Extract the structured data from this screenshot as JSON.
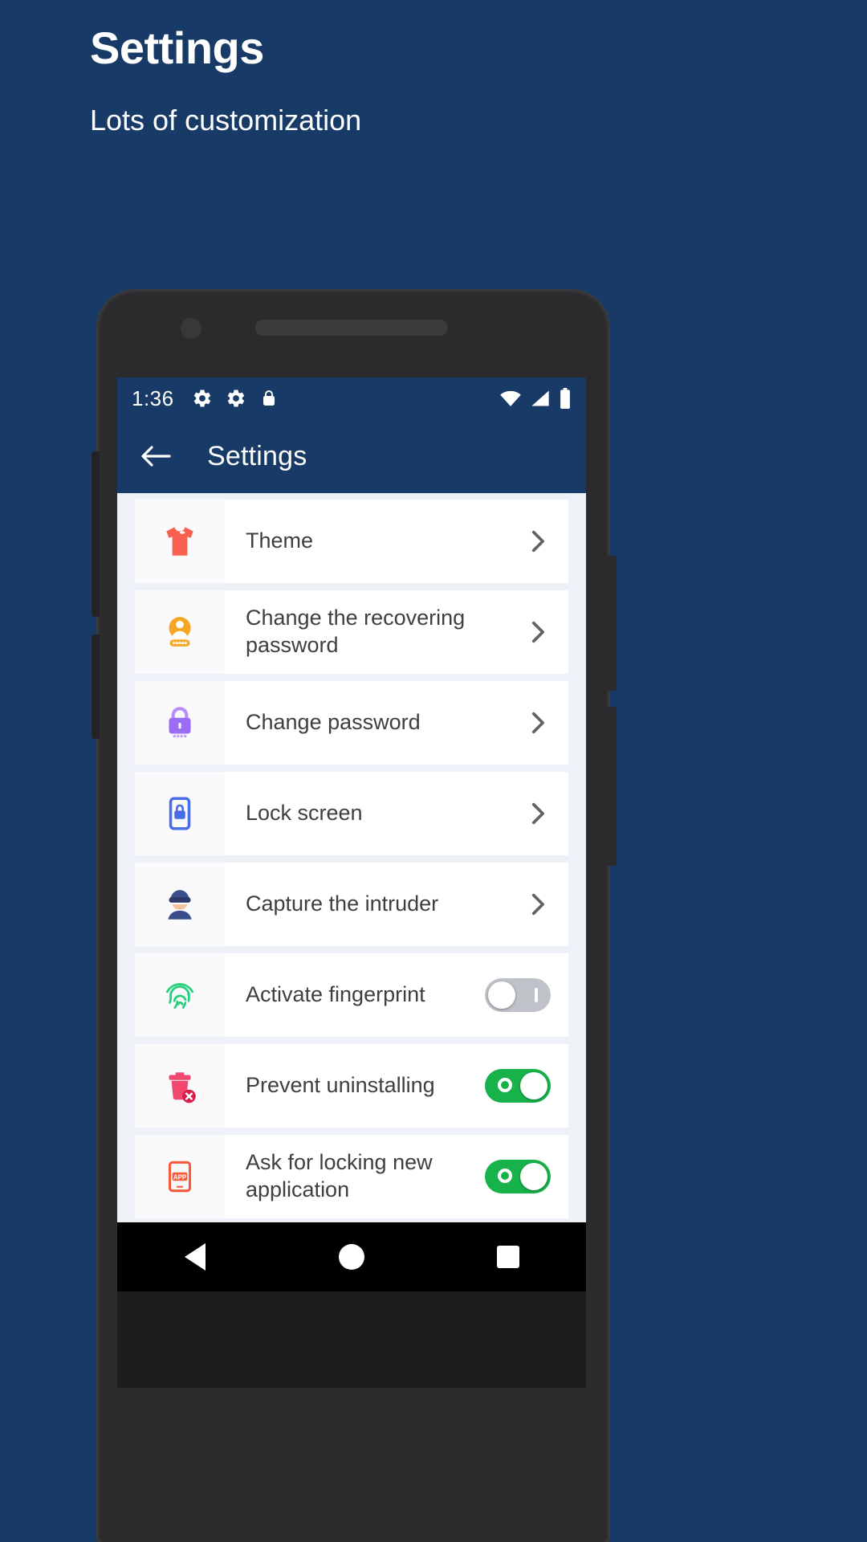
{
  "promo": {
    "title": "Settings",
    "subtitle": "Lots of customization",
    "background_color": "#173A66",
    "text_color": "#FFFFFF"
  },
  "phone": {
    "status_bar": {
      "time": "1:36",
      "left_icons": [
        "gear-icon",
        "gear-icon",
        "lock-icon"
      ],
      "right_icons": [
        "wifi-icon",
        "signal-icon",
        "battery-icon"
      ],
      "background_color": "#173A66"
    },
    "app_bar": {
      "back_label": "Back",
      "title": "Settings",
      "background_color": "#173A66"
    },
    "nav_bar": {
      "back_label": "Back",
      "home_label": "Home",
      "recents_label": "Recents"
    }
  },
  "settings_list": {
    "background_color": "#EFF1F9",
    "items": [
      {
        "label": "Theme",
        "icon": "tshirt-icon",
        "icon_color": "#F8604F",
        "control": "chevron"
      },
      {
        "label": "Change the recovering password",
        "icon": "user-password-icon",
        "icon_color": "#F5A623",
        "control": "chevron"
      },
      {
        "label": "Change password",
        "icon": "padlock-icon",
        "icon_color": "#9B6CF5",
        "control": "chevron"
      },
      {
        "label": "Lock screen",
        "icon": "phone-lock-icon",
        "icon_color": "#4B6CE8",
        "control": "chevron"
      },
      {
        "label": "Capture the intruder",
        "icon": "intruder-icon",
        "icon_color": "#3B4E8C",
        "control": "chevron"
      },
      {
        "label": "Activate fingerprint",
        "icon": "fingerprint-icon",
        "icon_color": "#25D07A",
        "control": "toggle",
        "toggle_state": "off"
      },
      {
        "label": "Prevent uninstalling",
        "icon": "uninstall-icon",
        "icon_color": "#F2486F",
        "control": "toggle",
        "toggle_state": "on"
      },
      {
        "label": "Ask for locking new application",
        "icon": "app-icon",
        "icon_color": "#FA5A3C",
        "control": "toggle",
        "toggle_state": "on"
      }
    ]
  },
  "colors": {
    "accent_navy": "#173A66",
    "toggle_on": "#18B24B",
    "toggle_off": "#BFC3C9",
    "row_white": "#FFFFFF",
    "icon_cell": "#FAFAFC"
  }
}
